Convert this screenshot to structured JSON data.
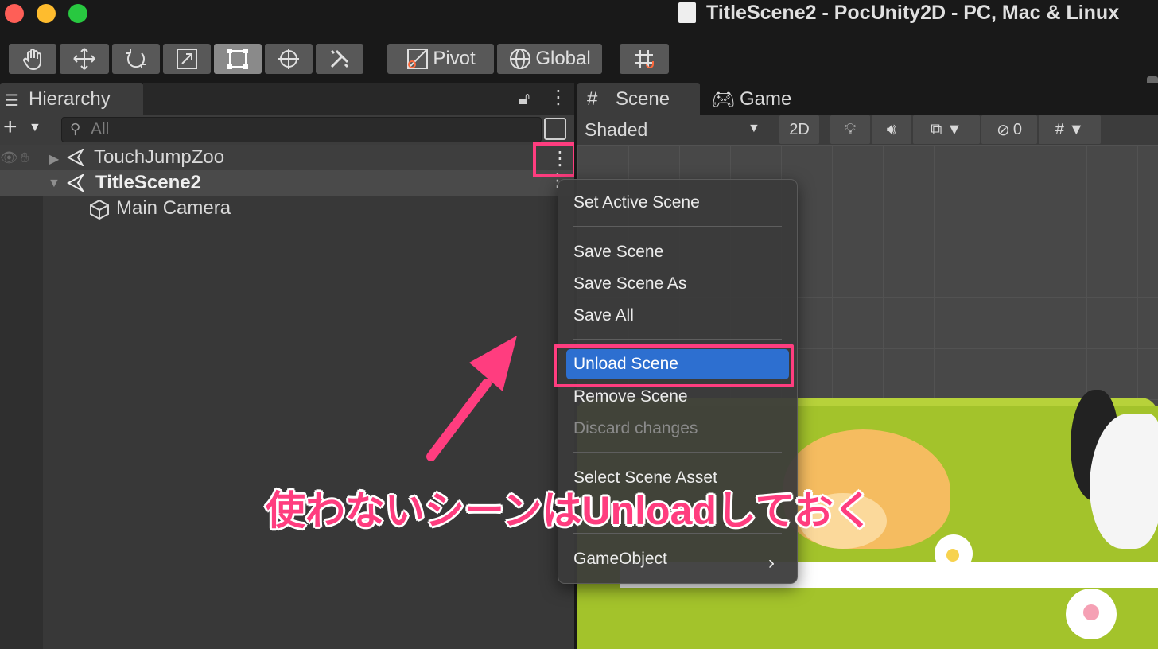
{
  "window": {
    "title": "TitleScene2 - PocUnity2D - PC, Mac & Linux",
    "traffic_lights": [
      "#fe5f57",
      "#febc2e",
      "#28c840"
    ]
  },
  "toolbar": {
    "tools": [
      {
        "name": "hand-tool",
        "icon": "hand-icon"
      },
      {
        "name": "move-tool",
        "icon": "move-icon"
      },
      {
        "name": "rotate-tool",
        "icon": "rotate-icon"
      },
      {
        "name": "scale-tool",
        "icon": "scale-icon"
      },
      {
        "name": "rect-tool",
        "icon": "rect-icon",
        "active": true
      },
      {
        "name": "transform-tool",
        "icon": "transform-icon"
      },
      {
        "name": "custom-tool",
        "icon": "tools-icon"
      }
    ],
    "pivot_label": "Pivot",
    "global_label": "Global"
  },
  "hierarchy": {
    "tab_label": "Hierarchy",
    "search_placeholder": "All",
    "scenes": [
      {
        "label": "TouchJumpZoo",
        "expanded": false
      },
      {
        "label": "TitleScene2",
        "expanded": true,
        "active": true
      }
    ],
    "objects": [
      {
        "label": "Main Camera"
      }
    ]
  },
  "scene_view": {
    "tabs": [
      {
        "label": "Scene"
      },
      {
        "label": "Game"
      }
    ],
    "shading_mode": "Shaded",
    "mode_2d_label": "2D",
    "hidden_count": "0"
  },
  "context_menu": {
    "items": [
      {
        "label": "Set Active Scene"
      },
      {
        "label": "Save Scene"
      },
      {
        "label": "Save Scene As"
      },
      {
        "label": "Save All"
      },
      {
        "label": "Unload Scene",
        "highlighted": true
      },
      {
        "label": "Remove Scene"
      },
      {
        "label": "Discard changes",
        "disabled": true
      },
      {
        "label": "Select Scene Asset"
      },
      {
        "label": "GameObject",
        "submenu": true
      }
    ]
  },
  "annotation": {
    "callout": "使わないシーンはUnloadしておく",
    "accent_color": "#ff3d7f"
  },
  "colors": {
    "menu_highlight": "#2d6fd0",
    "editor_bg": "#383838"
  }
}
